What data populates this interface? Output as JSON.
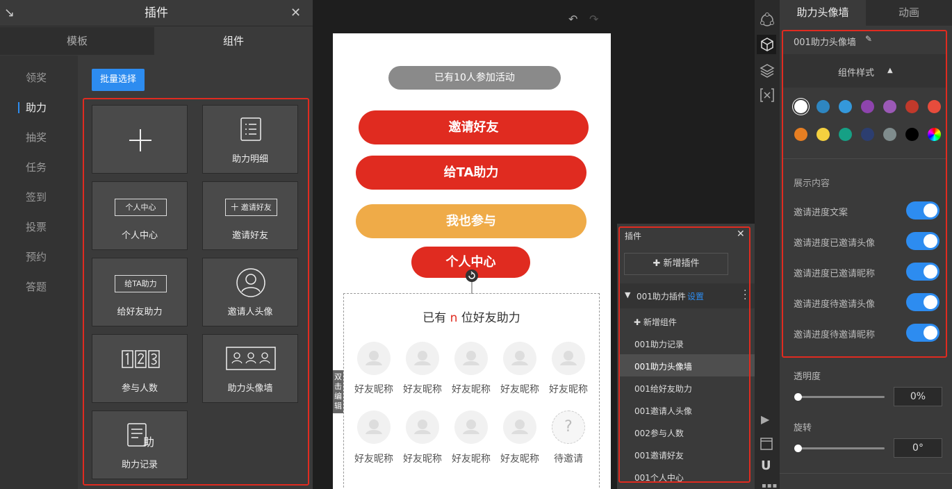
{
  "left_panel": {
    "title": "插件",
    "tabs": [
      "模板",
      "组件"
    ],
    "side_items": [
      "领奖",
      "助力",
      "抽奖",
      "任务",
      "签到",
      "投票",
      "预约",
      "答题"
    ],
    "batch_label": "批量选择",
    "cards": [
      {
        "label": ""
      },
      {
        "label": "助力明细"
      },
      {
        "label": "个人中心",
        "box": "个人中心"
      },
      {
        "label": "邀请好友",
        "box": "十 邀请好友"
      },
      {
        "label": "给好友助力",
        "box": "给TA助力"
      },
      {
        "label": "邀请人头像"
      },
      {
        "label": "参与人数"
      },
      {
        "label": "助力头像墙"
      },
      {
        "label": "助力记录"
      }
    ]
  },
  "canvas": {
    "pill": "已有10人参加活动",
    "btn_invite": "邀请好友",
    "btn_help": "给TA助力",
    "btn_join": "我也参与",
    "btn_center": "个人中心",
    "wall_title_pre": "已有 ",
    "wall_title_n": "n",
    "wall_title_post": " 位好友助力",
    "friend_label": "好友昵称",
    "pending_label": "待邀请",
    "pending_mark": "?",
    "double_click": "双击编辑"
  },
  "plugin_panel": {
    "title": "插件",
    "add_plugin": "新增插件",
    "group": "001助力插件",
    "settings": "设置",
    "add_component": "新增组件",
    "items": [
      "001助力记录",
      "001助力头像墙",
      "001给好友助力",
      "001邀请人头像",
      "002参与人数",
      "001邀请好友",
      "001个人中心"
    ]
  },
  "right_panel": {
    "tabs": [
      "助力头像墙",
      "动画"
    ],
    "component_name": "001助力头像墙",
    "style_label": "组件样式",
    "content_label": "展示内容",
    "toggles": [
      "邀请进度文案",
      "邀请进度已邀请头像",
      "邀请进度已邀请昵称",
      "邀请进度待邀请头像",
      "邀请进度待邀请昵称"
    ],
    "opacity_label": "透明度",
    "opacity_value": "0%",
    "opacity_fraction": 0,
    "rotate_label": "旋转",
    "rotate_value": "0°",
    "rotate_fraction": 0,
    "colors": [
      "#ffffff",
      "#2e86c1",
      "#3498db",
      "#8e44ad",
      "#9b59b6",
      "#c0392b",
      "#e74c3c",
      "#e67e22",
      "#f4d03f",
      "#16a085",
      "#2c3e70",
      "#7f8c8d",
      "#000000",
      "rainbow"
    ]
  },
  "accent_color": "#2d8cf0",
  "highlight_color": "#e02b20"
}
